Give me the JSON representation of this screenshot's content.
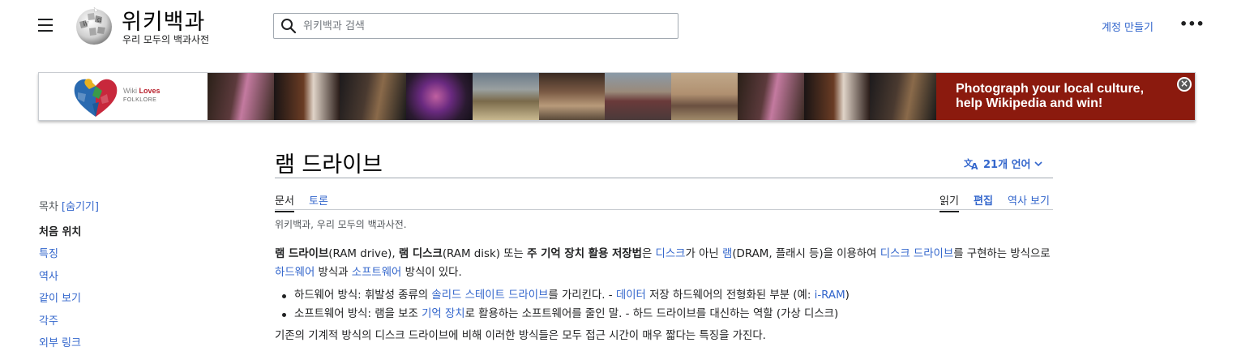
{
  "header": {
    "site_title": "위키백과",
    "site_tagline": "우리 모두의 백과사전",
    "search_placeholder": "위키백과 검색",
    "create_account": "계정 만들기",
    "more": "•••"
  },
  "banner": {
    "logo_word1": "Wiki",
    "logo_word2": "Loves",
    "logo_word3": "FOLKLORE",
    "cta_line1": "Photograph your local culture,",
    "cta_line2": "help Wikipedia and win!",
    "close": "×",
    "brand_color": "#8b1a0e"
  },
  "toc": {
    "heading": "목차",
    "hide": "[숨기기]",
    "items": [
      "처음 위치",
      "특징",
      "역사",
      "같이 보기",
      "각주",
      "외부 링크"
    ]
  },
  "article": {
    "title": "램 드라이브",
    "languages": "21개 언어",
    "tabs_left": [
      "문서",
      "토론"
    ],
    "tabs_right": [
      "읽기",
      "편집",
      "역사 보기"
    ],
    "site_sub": "위키백과, 우리 모두의 백과사전.",
    "p1": {
      "b1": "램 드라이브",
      "t1": "(RAM drive), ",
      "b2": "램 디스크",
      "t2": "(RAM disk) 또는 ",
      "b3": "주 기억 장치 활용 저장법",
      "t3": "은 ",
      "l1": "디스크",
      "t4": "가 아닌 ",
      "l2": "램",
      "t5": "(DRAM, 플래시 등)을 이용하여 ",
      "l3": "디스크 드라이브",
      "t6": "를 구현하는 방식으로 ",
      "l4": "하드웨어",
      "t7": " 방식과 ",
      "l5": "소프트웨어",
      "t8": " 방식이 있다."
    },
    "li1": {
      "t1": "하드웨어 방식: 휘발성 종류의 ",
      "l1": "솔리드 스테이트 드라이브",
      "t2": "를 가리킨다. - ",
      "l2": "데이터",
      "t3": " 저장 하드웨어의 전형화된 부분 (예: ",
      "l3": "i-RAM",
      "t4": ")"
    },
    "li2": {
      "t1": "소프트웨어 방식: 램을 보조 ",
      "l1": "기억 장치",
      "t2": "로 활용하는 소프트웨어를 줄인 말. - 하드 드라이브를 대신하는 역할 (가상 디스크)"
    },
    "p2": "기존의 기계적 방식의 디스크 드라이브에 비해 이러한 방식들은 모두 접근 시간이 매우 짧다는 특징을 가진다."
  },
  "colors": {
    "link": "#3366cc",
    "text": "#202122"
  }
}
